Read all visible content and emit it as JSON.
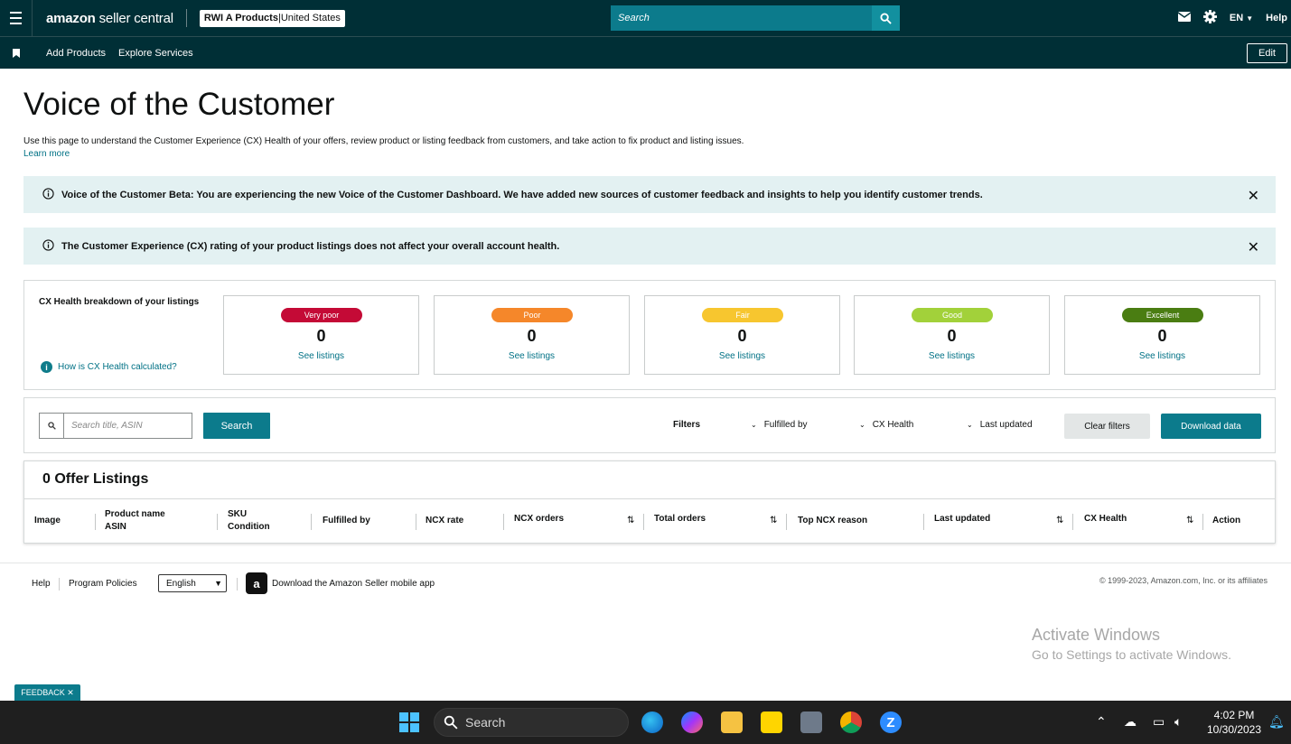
{
  "topnav": {
    "logo_main": "amazon",
    "logo_sub": " seller central",
    "account_name": "RWI A Products",
    "account_sep": " | ",
    "account_region": "United States",
    "search_placeholder": "Search",
    "lang": "EN",
    "help": "Help"
  },
  "subnav": {
    "items": [
      "Add Products",
      "Explore Services"
    ],
    "edit": "Edit"
  },
  "page": {
    "title": "Voice of the Customer",
    "description": "Use this page to understand the Customer Experience (CX) Health of your offers, review product or listing feedback from customers, and take action to fix product and listing issues.",
    "learn_more": "Learn more"
  },
  "alerts": [
    "Voice of the Customer Beta: You are experiencing the new Voice of the Customer Dashboard. We have added new sources of customer feedback and insights to help you identify customer trends.",
    "The Customer Experience (CX) rating of your product listings does not affect your overall account health."
  ],
  "cx_health": {
    "title": "CX Health breakdown of your listings",
    "how_link": "How is CX Health calculated?",
    "categories": [
      {
        "label": "Very poor",
        "count": "0",
        "link": "See listings",
        "color": "#c40a36"
      },
      {
        "label": "Poor",
        "count": "0",
        "link": "See listings",
        "color": "#f5872a"
      },
      {
        "label": "Fair",
        "count": "0",
        "link": "See listings",
        "color": "#f7c62f"
      },
      {
        "label": "Good",
        "count": "0",
        "link": "See listings",
        "color": "#a2d13a"
      },
      {
        "label": "Excellent",
        "count": "0",
        "link": "See listings",
        "color": "#4a7d12"
      }
    ]
  },
  "filters": {
    "search_placeholder": "Search title, ASIN",
    "search_button": "Search",
    "label": "Filters",
    "dropdowns": [
      "Fulfilled by",
      "CX Health",
      "Last updated"
    ],
    "clear": "Clear filters",
    "download": "Download data"
  },
  "table": {
    "title": "0 Offer Listings",
    "columns": {
      "image": "Image",
      "product_name": "Product name",
      "asin": "ASIN",
      "sku": "SKU",
      "condition": "Condition",
      "fulfilled": "Fulfilled by",
      "ncx_rate": "NCX rate",
      "ncx_orders": "NCX orders",
      "total_orders": "Total orders",
      "top_reason": "Top NCX reason",
      "last_updated": "Last updated",
      "cx_health": "CX Health",
      "action": "Action"
    }
  },
  "footer": {
    "help": "Help",
    "policies": "Program Policies",
    "language": "English",
    "app": "Download the Amazon Seller mobile app",
    "copyright": "© 1999-2023, Amazon.com, Inc. or its affiliates"
  },
  "watermark": {
    "line1": "Activate Windows",
    "line2": "Go to Settings to activate Windows."
  },
  "feedback": "FEEDBACK ✕",
  "taskbar": {
    "search": "Search",
    "time": "4:02 PM",
    "date": "10/30/2023"
  }
}
